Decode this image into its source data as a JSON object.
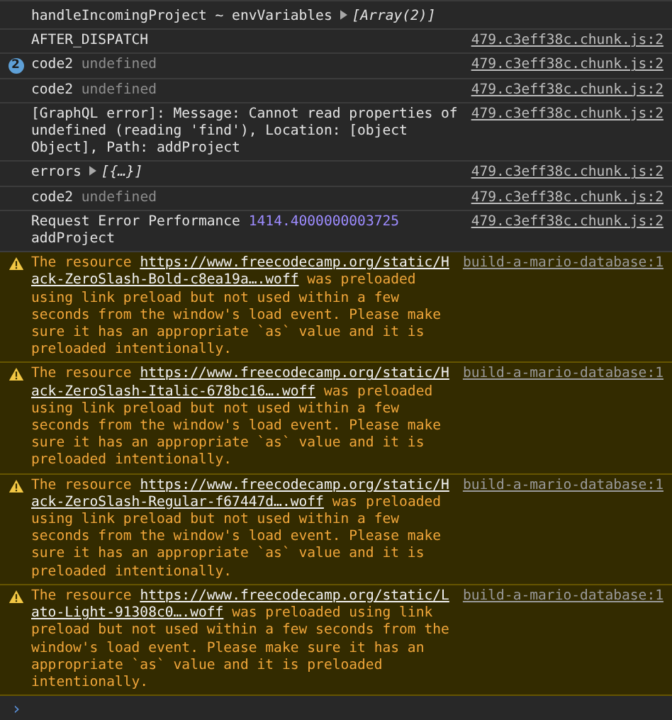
{
  "console": {
    "messages": [
      {
        "kind": "log",
        "parts": [
          {
            "kind": "text",
            "text": "handleIncomingProject ~ envVariables"
          },
          {
            "kind": "expand",
            "text": "[Array(2)]"
          }
        ]
      },
      {
        "kind": "log",
        "source": "479.c3eff38c.chunk.js:2",
        "parts": [
          {
            "kind": "text",
            "text": "AFTER_DISPATCH"
          }
        ]
      },
      {
        "kind": "log",
        "count": "2",
        "source": "479.c3eff38c.chunk.js:2",
        "parts": [
          {
            "kind": "text",
            "text": "code2"
          },
          {
            "kind": "dim",
            "text": "undefined"
          }
        ]
      },
      {
        "kind": "log",
        "source": "479.c3eff38c.chunk.js:2",
        "parts": [
          {
            "kind": "text",
            "text": "code2"
          },
          {
            "kind": "dim",
            "text": "undefined"
          }
        ]
      },
      {
        "kind": "log",
        "source": "479.c3eff38c.chunk.js:2",
        "parts": [
          {
            "kind": "text",
            "text": "[GraphQL error]: Message: Cannot read properties of undefined (reading 'find'), Location: [object Object], Path: addProject"
          }
        ]
      },
      {
        "kind": "log",
        "source": "479.c3eff38c.chunk.js:2",
        "parts": [
          {
            "kind": "text",
            "text": "errors"
          },
          {
            "kind": "expand",
            "text": "[{…}]"
          }
        ]
      },
      {
        "kind": "log",
        "source": "479.c3eff38c.chunk.js:2",
        "parts": [
          {
            "kind": "text",
            "text": "code2"
          },
          {
            "kind": "dim",
            "text": "undefined"
          }
        ]
      },
      {
        "kind": "log",
        "source": "479.c3eff38c.chunk.js:2",
        "parts": [
          {
            "kind": "text",
            "text": "Request Error Performance"
          },
          {
            "kind": "number",
            "text": "1414.4000000003725"
          },
          {
            "kind": "text",
            "text": "addProject"
          }
        ]
      },
      {
        "kind": "warning",
        "source": "build-a-mario-database:1",
        "parts": [
          {
            "kind": "text",
            "text": "The resource"
          },
          {
            "kind": "url",
            "text": "https://www.freecodecamp.org/static/Hack-ZeroSlash-Bold-c8ea19a….woff"
          },
          {
            "kind": "text",
            "text": "was preloaded using link preload but not used within a few seconds from the window's load event. Please make sure it has an appropriate `as` value and it is preloaded intentionally."
          }
        ]
      },
      {
        "kind": "warning",
        "source": "build-a-mario-database:1",
        "parts": [
          {
            "kind": "text",
            "text": "The resource"
          },
          {
            "kind": "url",
            "text": "https://www.freecodecamp.org/static/Hack-ZeroSlash-Italic-678bc16….woff"
          },
          {
            "kind": "text",
            "text": "was preloaded using link preload but not used within a few seconds from the window's load event. Please make sure it has an appropriate `as` value and it is preloaded intentionally."
          }
        ]
      },
      {
        "kind": "warning",
        "source": "build-a-mario-database:1",
        "parts": [
          {
            "kind": "text",
            "text": "The resource"
          },
          {
            "kind": "url",
            "text": "https://www.freecodecamp.org/static/Hack-ZeroSlash-Regular-f67447d….woff"
          },
          {
            "kind": "text",
            "text": "was preloaded using link preload but not used within a few seconds from the window's load event. Please make sure it has an appropriate `as` value and it is preloaded intentionally."
          }
        ]
      },
      {
        "kind": "warning",
        "source": "build-a-mario-database:1",
        "parts": [
          {
            "kind": "text",
            "text": "The resource"
          },
          {
            "kind": "url",
            "text": "https://www.freecodecamp.org/static/Lato-Light-91308c0….woff"
          },
          {
            "kind": "text",
            "text": "was preloaded using link preload but not used within a few seconds from the window's load event. Please make sure it has an appropriate `as` value and it is preloaded intentionally."
          }
        ]
      }
    ],
    "prompt": {
      "symbol": "›"
    }
  }
}
